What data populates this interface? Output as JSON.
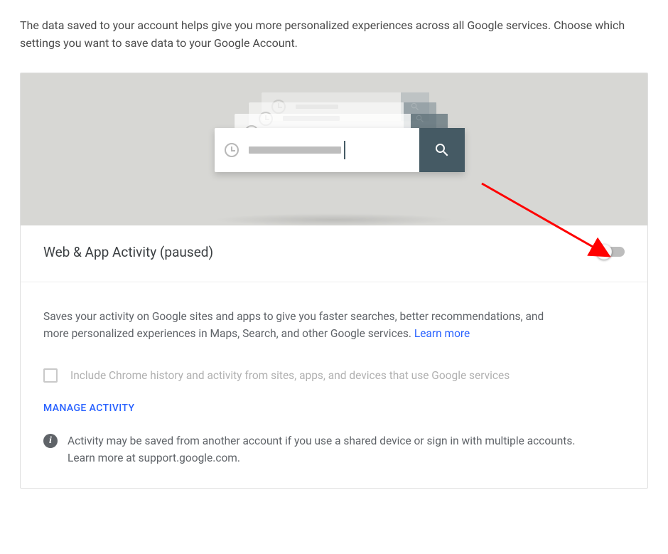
{
  "intro": "The data saved to your account helps give you more personalized experiences across all Google services. Choose which settings you want to save data to your Google Account.",
  "section": {
    "title": "Web & App Activity (paused)",
    "toggle_on": false,
    "description": "Saves your activity on Google sites and apps to give you faster searches, better recommendations, and more personalized experiences in Maps, Search, and other Google services. ",
    "learn_more": "Learn more",
    "checkbox": {
      "checked": false,
      "label": "Include Chrome history and activity from sites, apps, and devices that use Google services"
    },
    "manage_label": "MANAGE ACTIVITY",
    "info_text": "Activity may be saved from another account if you use a shared device or sign in with multiple accounts. Learn more at support.google.com."
  }
}
